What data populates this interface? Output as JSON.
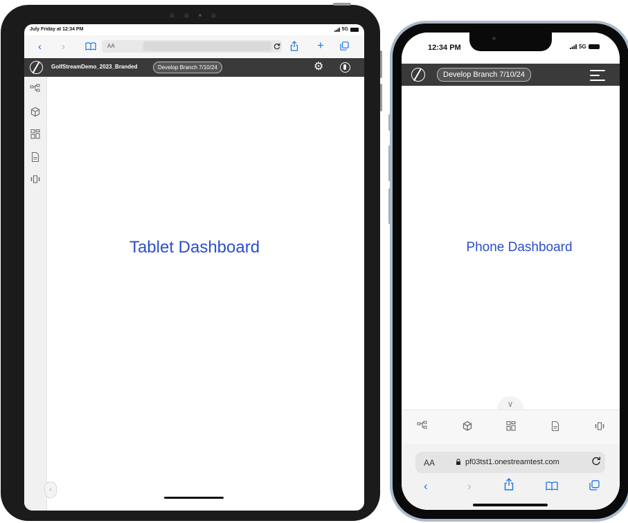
{
  "tablet": {
    "status_time": "July Friday at 12:34 PM",
    "status_network": "5G",
    "safari": {
      "text_size_label": "AA"
    },
    "app_title": "GolfStreamDemo_2023_Branded",
    "branch_label": "Develop Branch 7/10/24",
    "dashboard_label": "Tablet Dashboard",
    "sidebar_icons": [
      "model-icon",
      "cube-icon",
      "dashboard-grid-icon",
      "document-icon",
      "carousel-icon"
    ]
  },
  "phone": {
    "status_time": "12:34 PM",
    "status_network": "5G",
    "branch_label": "Develop Branch 7/10/24",
    "dashboard_label": "Phone Dashboard",
    "tab_icons": [
      "model-icon",
      "cube-icon",
      "dashboard-grid-icon",
      "document-icon",
      "carousel-icon"
    ],
    "safari": {
      "text_size_label": "AA",
      "domain": "pf03tst1.onestreamtest.com"
    }
  },
  "colors": {
    "accent_blue": "#1a73e8",
    "dashboard_text": "#2b4dce",
    "app_bar": "#3a3a3a",
    "device_frame": "#1b1b1b",
    "phone_frame": "#a9bacb"
  }
}
